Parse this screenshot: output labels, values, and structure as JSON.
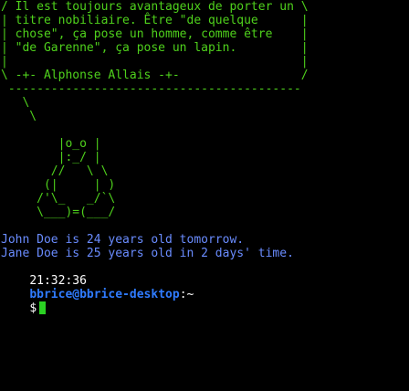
{
  "colors": {
    "background": "#000000",
    "art": "#4fd11c",
    "output": "#6a8cff",
    "prompt_user": "#2f7bff",
    "prompt_text": "#ffffff",
    "cursor": "#2bd123"
  },
  "terminal": {
    "art_lines": [
      "/ Il est toujours avantageux de porter un \\",
      "| titre nobiliaire. Être \"de quelque      |",
      "| chose\", ça pose un homme, comme être    |",
      "| \"de Garenne\", ça pose un lapin.         |",
      "|                                         |",
      "\\ -+- Alphonse Allais -+-                 /",
      " -----------------------------------------",
      "   \\",
      "    \\",
      "",
      "        |o_o |",
      "        |:_/ |",
      "       //   \\ \\",
      "      (|     | )",
      "     /'\\_   _/`\\",
      "     \\___)=(___/",
      ""
    ],
    "output_lines": [
      "John Doe is 24 years old tomorrow.",
      "Jane Doe is 25 years old in 2 days' time."
    ],
    "prompt": {
      "time": "21:32:36",
      "user_host": "bbrice@bbrice-desktop",
      "separator": ":",
      "path": "~",
      "symbol": "$"
    }
  }
}
